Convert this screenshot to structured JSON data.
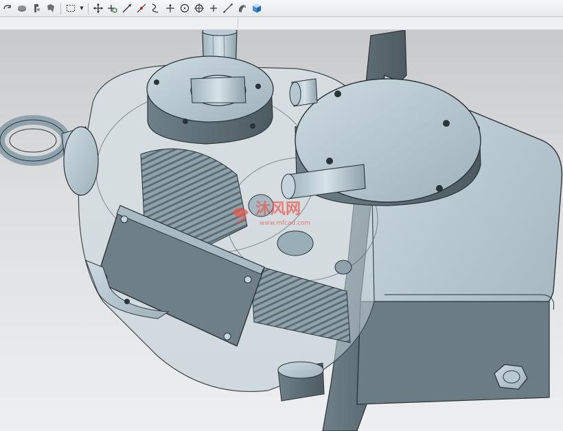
{
  "toolbar": {
    "tools": [
      {
        "name": "rotate-arrow-icon"
      },
      {
        "name": "shaded-view-icon"
      },
      {
        "name": "pan-move-icon"
      },
      {
        "name": "fit-view-icon"
      },
      {
        "name": "selection-box-icon"
      },
      {
        "name": "move-handle-icon"
      },
      {
        "name": "multi-move-icon"
      },
      {
        "name": "line-tool-icon"
      },
      {
        "name": "point-on-curve-icon"
      },
      {
        "name": "curve-tool-icon"
      },
      {
        "name": "datum-axis-icon"
      },
      {
        "name": "circle-center-icon"
      },
      {
        "name": "target-point-icon"
      },
      {
        "name": "cross-point-icon"
      },
      {
        "name": "vector-line-icon"
      },
      {
        "name": "render-style-icon"
      },
      {
        "name": "3d-cube-view-icon"
      }
    ]
  },
  "viewport": {
    "watermark_text": "沐风网",
    "watermark_url": "www.mfcad.com"
  },
  "colors": {
    "metal": "#a9bcc6",
    "metal_light": "#c6d6de",
    "metal_dark": "#5f7078",
    "edge": "#2a3338",
    "watermark": "#e85a4f"
  }
}
